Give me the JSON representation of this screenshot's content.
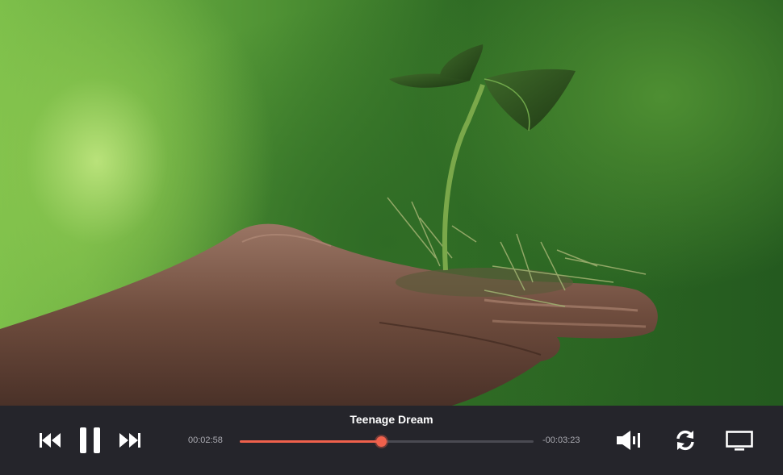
{
  "player": {
    "track_title": "Teenage Dream",
    "time_elapsed": "00:02:58",
    "time_remaining": "-00:03:23",
    "progress_fraction": 0.48,
    "state": "playing"
  },
  "controls": {
    "previous": "skip-back-icon",
    "pause": "pause-icon",
    "next": "skip-forward-icon",
    "volume": "volume-icon",
    "repeat": "repeat-icon",
    "screen": "screen-cast-icon"
  },
  "colors": {
    "accent": "#f0614c",
    "bar_background": "#25252b",
    "track": "#4a4a52"
  }
}
